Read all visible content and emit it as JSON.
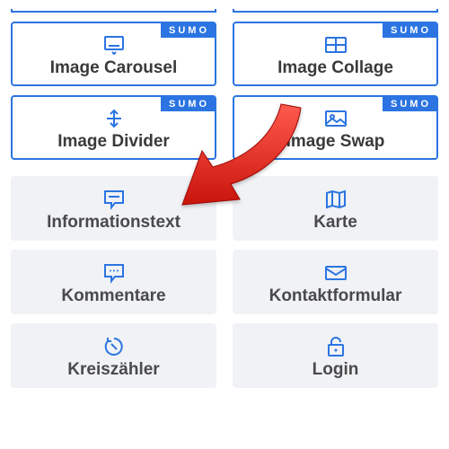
{
  "badge_label": "SUMO",
  "cards": {
    "carousel": {
      "label": "Image Carousel"
    },
    "collage": {
      "label": "Image Collage"
    },
    "divider": {
      "label": "Image Divider"
    },
    "swap": {
      "label": "Image Swap"
    },
    "infotext": {
      "label": "Informationstext"
    },
    "karte": {
      "label": "Karte"
    },
    "kommentare": {
      "label": "Kommentare"
    },
    "kontakt": {
      "label": "Kontaktformular"
    },
    "kreis": {
      "label": "Kreiszähler"
    },
    "login": {
      "label": "Login"
    }
  }
}
